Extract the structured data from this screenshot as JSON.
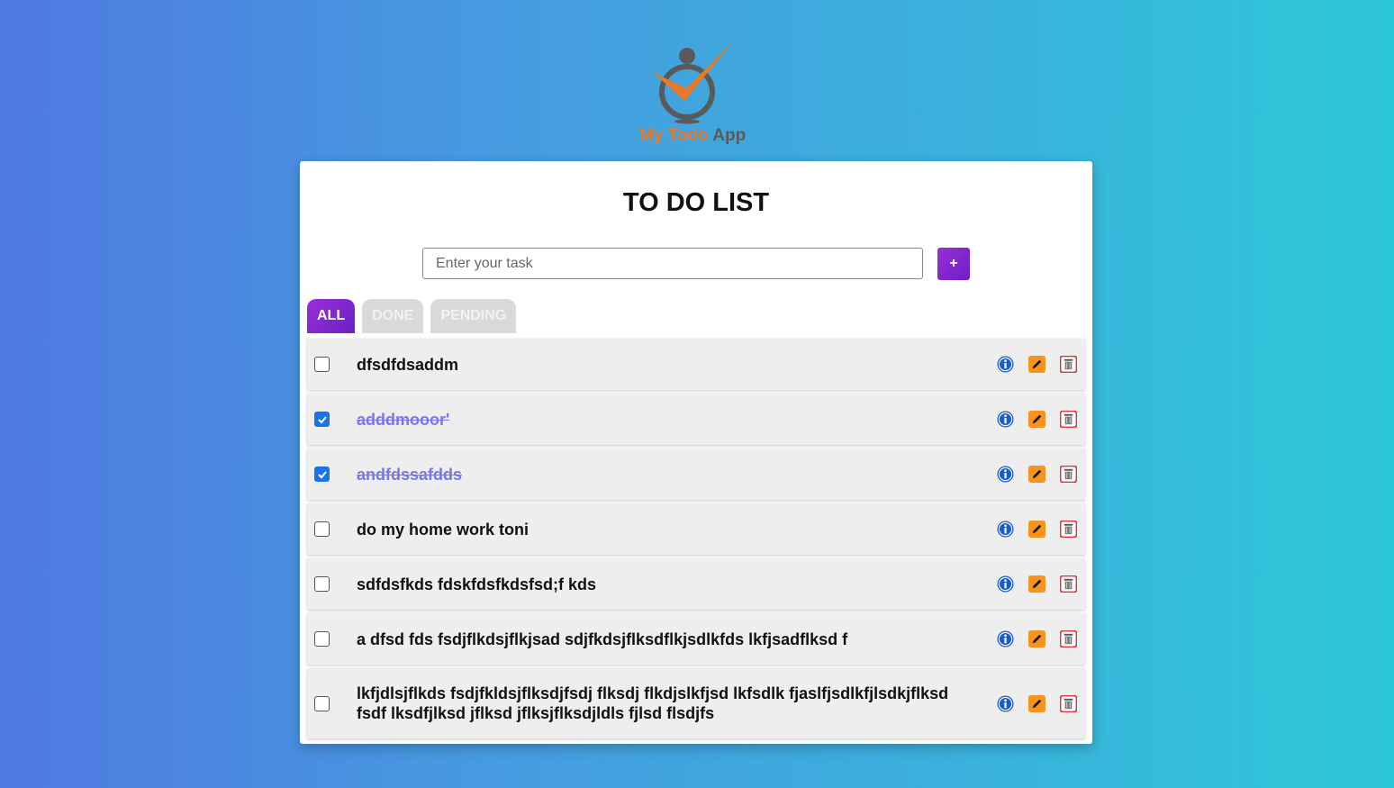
{
  "logo": {
    "text_my": "My Todo",
    "text_app": "App"
  },
  "card": {
    "title": "TO DO LIST"
  },
  "input": {
    "placeholder": "Enter your task",
    "value": ""
  },
  "add_button": {
    "label": "+"
  },
  "tabs": [
    {
      "label": "ALL",
      "active": true
    },
    {
      "label": "DONE",
      "active": false
    },
    {
      "label": "PENDING",
      "active": false
    }
  ],
  "tasks": [
    {
      "text": "dfsdfdsaddm",
      "done": false
    },
    {
      "text": "adddmooor'",
      "done": true
    },
    {
      "text": "andfdssafdds",
      "done": true
    },
    {
      "text": "do my home work toni",
      "done": false
    },
    {
      "text": "sdfdsfkds fdskfdsfkdsfsd;f kds",
      "done": false
    },
    {
      "text": "a dfsd fds fsdjflkdsjflkjsad sdjfkdsjflksdflkjsdlkfds lkfjsadflksd f",
      "done": false
    },
    {
      "text": "lkfjdlsjflkds fsdjfkldsjflksdjfsdj flksdj flkdjslkfjsd lkfsdlk fjaslfjsdlkfjlsdkjflksd fsdf lksdfjlksd jflksd jflksjflksdjldls fjlsd flsdjfs",
      "done": false
    }
  ],
  "icons": {
    "info": "info-icon",
    "edit": "pencil-icon",
    "delete": "trash-icon"
  },
  "colors": {
    "accent": "#7a24cf",
    "info": "#1a5cc8",
    "edit": "#f7941d",
    "delete": "#e0353b",
    "done_text": "#7b74f0"
  }
}
